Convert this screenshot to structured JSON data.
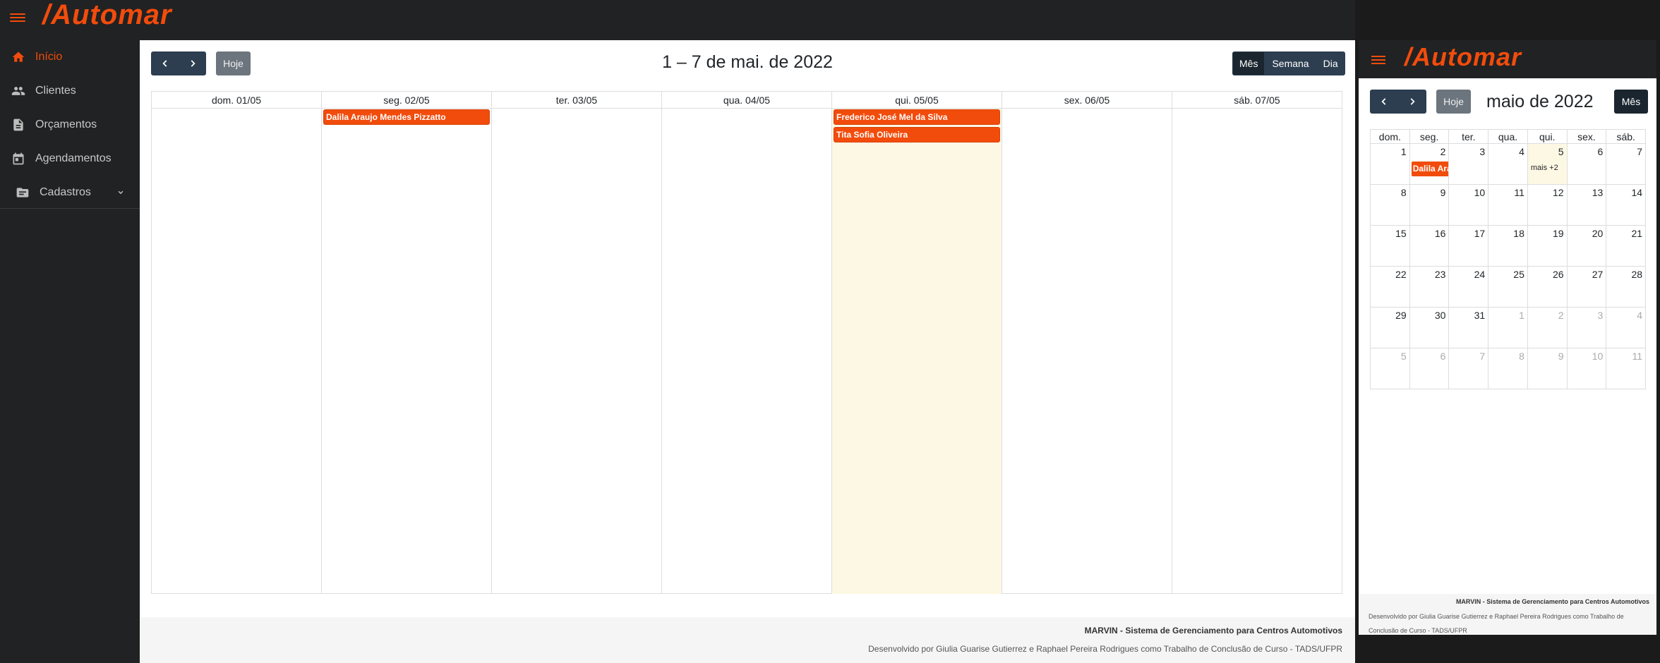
{
  "brand": {
    "logo_text": "/Automar",
    "accent_color": "#f24c0c"
  },
  "sidebar": {
    "items": [
      {
        "label": "Início",
        "icon": "home-icon",
        "active": true
      },
      {
        "label": "Clientes",
        "icon": "users-icon",
        "active": false
      },
      {
        "label": "Orçamentos",
        "icon": "invoice-icon",
        "active": false
      },
      {
        "label": "Agendamentos",
        "icon": "calendar-icon",
        "active": false
      },
      {
        "label": "Cadastros",
        "icon": "folder-icon",
        "active": false,
        "expandable": true
      }
    ]
  },
  "calendar": {
    "today_label": "Hoje",
    "title": "1 – 7 de mai. de 2022",
    "views": [
      "Mês",
      "Semana",
      "Dia"
    ],
    "active_view": "Mês",
    "days": [
      {
        "label": "dom. 01/05"
      },
      {
        "label": "seg. 02/05"
      },
      {
        "label": "ter. 03/05"
      },
      {
        "label": "qua. 04/05"
      },
      {
        "label": "qui. 05/05",
        "today": true
      },
      {
        "label": "sex. 06/05"
      },
      {
        "label": "sáb. 07/05"
      }
    ],
    "events": [
      {
        "day": 1,
        "title": "Dalila Araujo Mendes Pizzatto"
      },
      {
        "day": 4,
        "title": "Frederico José Mel da Silva"
      },
      {
        "day": 4,
        "title": "Tita Sofia Oliveira"
      }
    ]
  },
  "footer": {
    "title": "MARVIN - Sistema de Gerenciamento para Centros Automotivos",
    "credits": "Desenvolvido por Giulia Guarise Gutierrez e Raphael Pereira Rodrigues como Trabalho de Conclusão de Curso - TADS/UFPR"
  },
  "mobile": {
    "today_label": "Hoje",
    "title": "maio de 2022",
    "view_label": "Mês",
    "weekdays": [
      "dom.",
      "seg.",
      "ter.",
      "qua.",
      "qui.",
      "sex.",
      "sáb."
    ],
    "weeks": [
      [
        "1",
        "2",
        "3",
        "4",
        "5",
        "6",
        "7"
      ],
      [
        "8",
        "9",
        "10",
        "11",
        "12",
        "13",
        "14"
      ],
      [
        "15",
        "16",
        "17",
        "18",
        "19",
        "20",
        "21"
      ],
      [
        "22",
        "23",
        "24",
        "25",
        "26",
        "27",
        "28"
      ],
      [
        "29",
        "30",
        "31",
        "1",
        "2",
        "3",
        "4"
      ],
      [
        "5",
        "6",
        "7",
        "8",
        "9",
        "10",
        "11"
      ]
    ],
    "event_snippet": "Dalila Ara",
    "more_label": "mais +2",
    "footer_title": "MARVIN - Sistema de Gerenciamento para Centros Automotivos",
    "footer_credits": "Desenvolvido por Giulia Guarise Gutierrez e Raphael Pereira Rodrigues como Trabalho de Conclusão de Curso - TADS/UFPR"
  }
}
